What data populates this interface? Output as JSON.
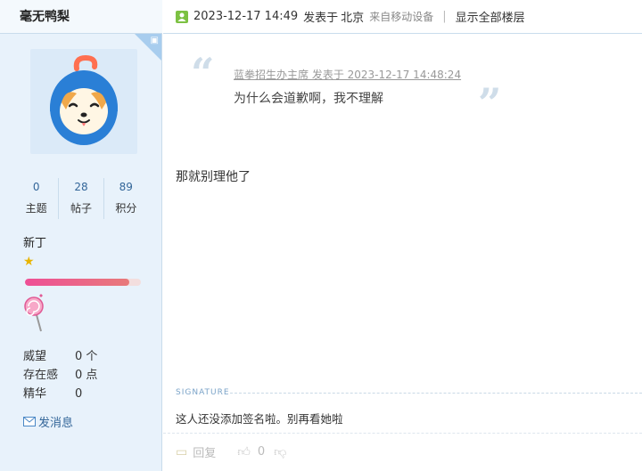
{
  "author": {
    "name": "毫无鸭梨",
    "stats": [
      {
        "value": "0",
        "label": "主题"
      },
      {
        "value": "28",
        "label": "帖子"
      },
      {
        "value": "89",
        "label": "积分"
      }
    ],
    "rank": "新丁",
    "rank_star_icon": "star-icon",
    "progress": 0.9,
    "props": [
      {
        "key": "威望",
        "value": "0 个"
      },
      {
        "key": "存在感",
        "value": "0 点"
      },
      {
        "key": "精华",
        "value": "0"
      }
    ],
    "send_message": "发消息"
  },
  "post": {
    "header": {
      "date": "2023-12-17 14:49",
      "posted_in_prefix": "发表于",
      "location": "北京",
      "device": "来自移动设备",
      "separator": "|",
      "show_all": "显示全部楼层"
    },
    "quote": {
      "meta": "蓝拳招生办主席 发表于 2023-12-17 14:48:24",
      "text": "为什么会道歉啊，我不理解"
    },
    "content": "那就别理他了",
    "signature": {
      "label": "SIGNATURE",
      "text": "这人还没添加签名啦。别再看她啦"
    },
    "actions": {
      "reply": "回复",
      "like_count": "0"
    }
  },
  "colors": {
    "sidebar_bg": "#e8f2fb",
    "link": "#336699",
    "progress_fill": "#ee4f96"
  }
}
